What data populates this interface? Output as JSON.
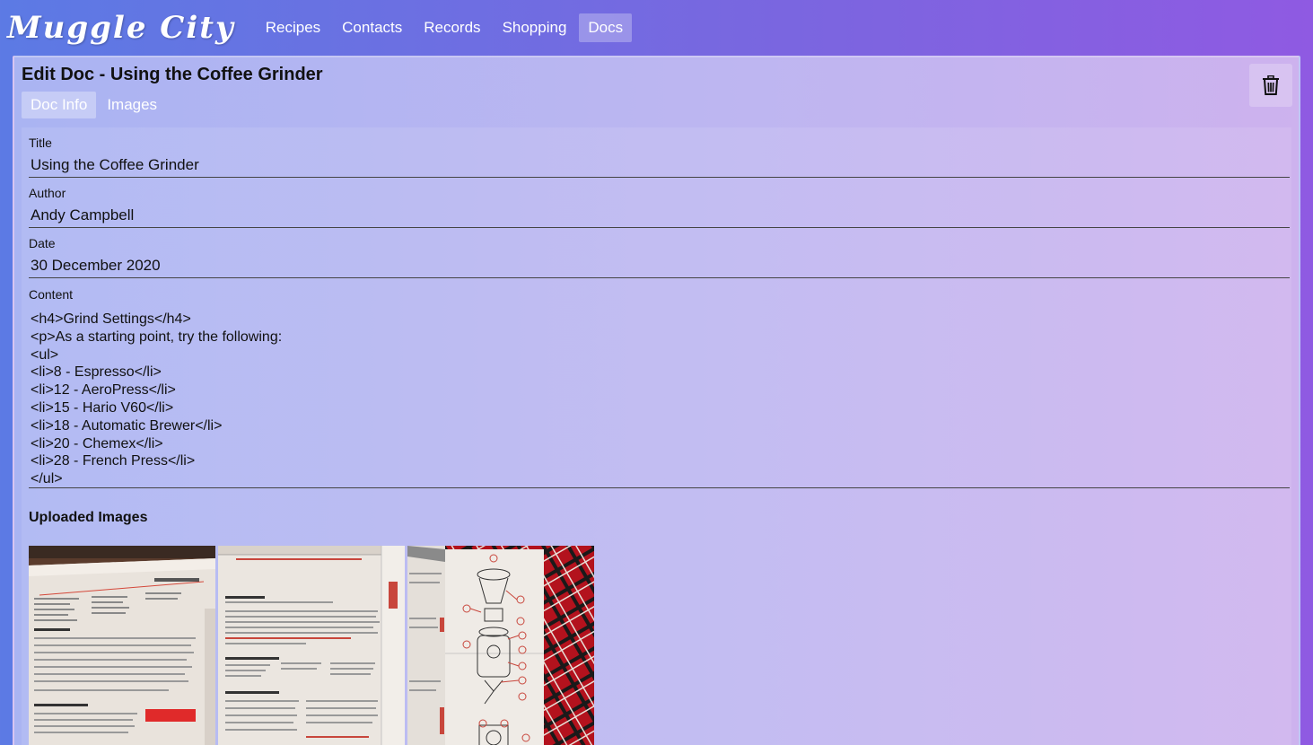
{
  "app": {
    "logo": "Muggle City"
  },
  "nav": {
    "items": [
      {
        "label": "Recipes"
      },
      {
        "label": "Contacts"
      },
      {
        "label": "Records"
      },
      {
        "label": "Shopping"
      },
      {
        "label": "Docs"
      }
    ],
    "active": "Docs"
  },
  "page": {
    "title": "Edit Doc - Using the Coffee Grinder",
    "tabs": [
      {
        "label": "Doc Info"
      },
      {
        "label": "Images"
      }
    ],
    "active_tab": "Doc Info"
  },
  "form": {
    "title_label": "Title",
    "title_value": "Using the Coffee Grinder",
    "author_label": "Author",
    "author_value": "Andy Campbell",
    "date_label": "Date",
    "date_value": "30 December 2020",
    "content_label": "Content",
    "content_value": "<h4>Grind Settings</h4>\n<p>As a starting point, try the following:\n<ul>\n<li>8 - Espresso</li>\n<li>12 - AeroPress</li>\n<li>15 - Hario V60</li>\n<li>18 - Automatic Brewer</li>\n<li>20 - Chemex</li>\n<li>28 - French Press</li>\n</ul>"
  },
  "uploaded": {
    "heading": "Uploaded Images",
    "images": [
      {
        "name": "quick-start-guide-photo"
      },
      {
        "name": "programming-instructions-photo"
      },
      {
        "name": "grinder-diagram-photo"
      }
    ]
  },
  "icons": {
    "delete": "trash-icon"
  }
}
